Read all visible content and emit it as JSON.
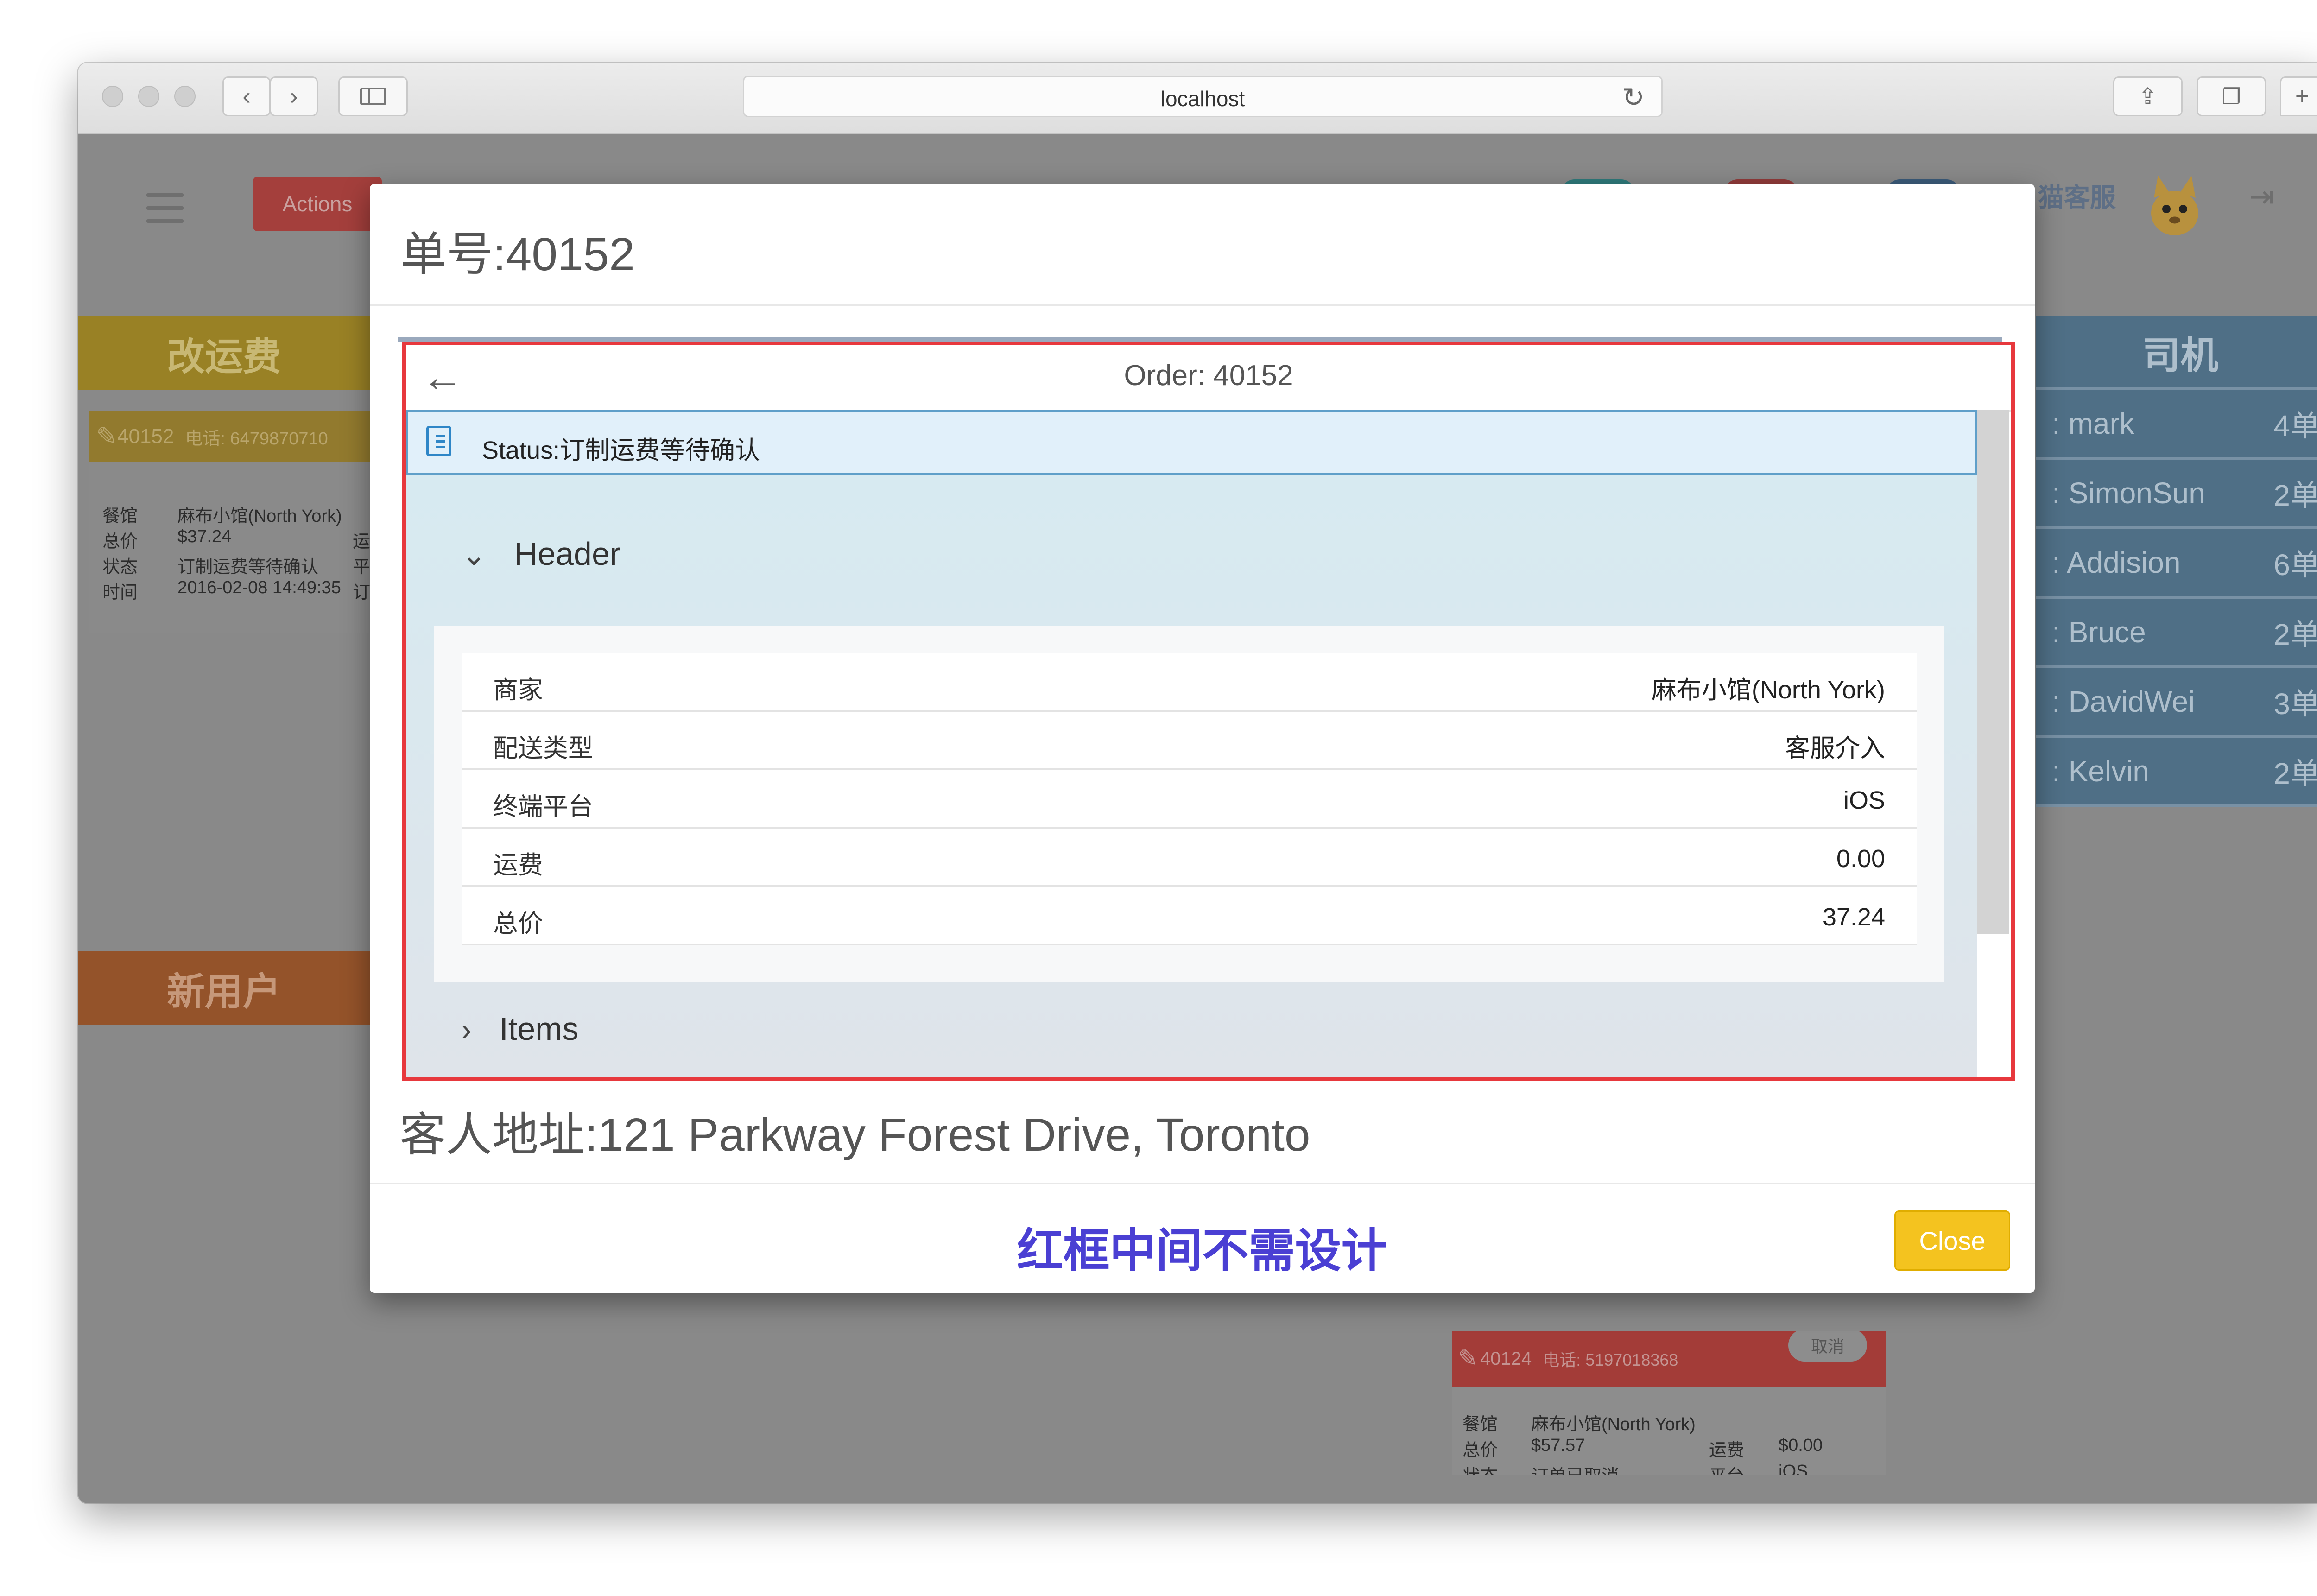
{
  "browser": {
    "address": "localhost"
  },
  "page": {
    "actions_label": "Actions",
    "panel_change_fee": "改运费",
    "panel_new_users": "新用户",
    "panel_drivers": "司机",
    "service_label": "猫客服",
    "order_card": {
      "header": "40152",
      "phone": "电话: 6479870710",
      "rows": [
        {
          "k": "餐馆",
          "v": "麻布小馆(North York)",
          "extra": ""
        },
        {
          "k": "总价",
          "v": "$37.24",
          "extra": "运"
        },
        {
          "k": "状态",
          "v": "订制运费等待确认",
          "extra": "平"
        },
        {
          "k": "时间",
          "v": "2016-02-08 14:49:35",
          "extra": "订"
        }
      ]
    },
    "drivers": [
      {
        "name": ": mark",
        "count": "4单"
      },
      {
        "name": ": SimonSun",
        "count": "2单"
      },
      {
        "name": ": Addision",
        "count": "6单"
      },
      {
        "name": ": Bruce",
        "count": "2单"
      },
      {
        "name": ": DavidWei",
        "count": "3单"
      },
      {
        "name": ": Kelvin",
        "count": "2单"
      }
    ],
    "order_card2": {
      "header": "40124",
      "phone": "电话: 5197018368",
      "cancel": "取消",
      "r1k": "餐馆",
      "r1v": "麻布小馆(North York)",
      "r2k": "总价",
      "r2v": "$57.57",
      "r2k2": "运费",
      "r2v2": "$0.00",
      "r3k": "状态",
      "r3v": "订单已取消",
      "r3k2": "平台",
      "r3v2": "iOS"
    }
  },
  "modal": {
    "title": "单号:40152",
    "embed": {
      "nav_title": "Order: 40152",
      "status": "Status:订制运费等待确认",
      "header_section": "Header",
      "items_section": "Items",
      "rows": [
        {
          "key": "商家",
          "value": "麻布小馆(North York)"
        },
        {
          "key": "配送类型",
          "value": "客服介入"
        },
        {
          "key": "终端平台",
          "value": "iOS"
        },
        {
          "key": "运费",
          "value": "0.00"
        },
        {
          "key": "总价",
          "value": "37.24"
        }
      ]
    },
    "address": "客人地址:121 Parkway Forest Drive, Toronto",
    "note": "红框中间不需设计",
    "close_label": "Close"
  }
}
